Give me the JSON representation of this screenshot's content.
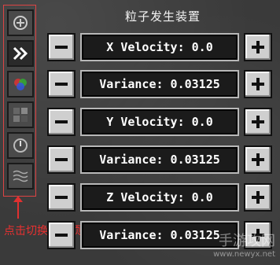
{
  "title": "粒子发生装置",
  "hint": "点击切换设置项",
  "tabs": [
    {
      "icon": "plus-circle-icon"
    },
    {
      "icon": "double-chevron-right-icon"
    },
    {
      "icon": "color-wheel-icon"
    },
    {
      "icon": "texture-icon"
    },
    {
      "icon": "clock-icon"
    },
    {
      "icon": "wave-icon"
    }
  ],
  "rows": [
    {
      "label": "X Velocity: 0.0"
    },
    {
      "label": "Variance: 0.03125"
    },
    {
      "label": "Y Velocity: 0.0"
    },
    {
      "label": "Variance: 0.03125"
    },
    {
      "label": "Z Velocity: 0.0"
    },
    {
      "label": "Variance: 0.03125"
    }
  ],
  "watermark": {
    "text": "手游攻网",
    "url": "www.newyx.net"
  },
  "colors": {
    "annotation": "#e03030",
    "button": "#cfcfcf",
    "field": "#1b1b1b"
  }
}
